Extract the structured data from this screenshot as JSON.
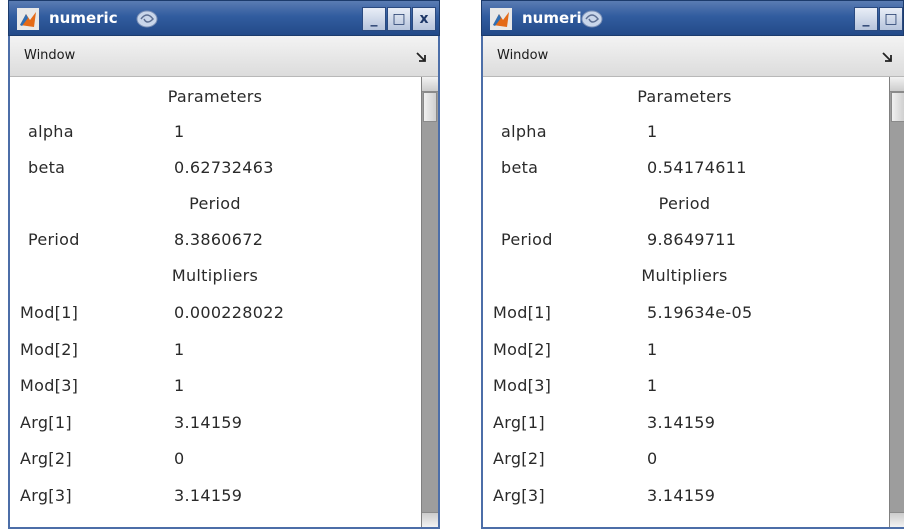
{
  "windows": [
    {
      "title": "numeric",
      "menu": "Window",
      "sections": {
        "parameters_title": "Parameters",
        "period_title": "Period",
        "multipliers_title": "Multipliers"
      },
      "parameters": [
        {
          "key": "alpha",
          "value": "1"
        },
        {
          "key": "beta",
          "value": "0.62732463"
        }
      ],
      "period": [
        {
          "key": "Period",
          "value": "8.3860672"
        }
      ],
      "multipliers": [
        {
          "key": "Mod[1]",
          "value": "0.000228022"
        },
        {
          "key": "Mod[2]",
          "value": "1"
        },
        {
          "key": "Mod[3]",
          "value": "1"
        },
        {
          "key": "Arg[1]",
          "value": "3.14159"
        },
        {
          "key": "Arg[2]",
          "value": "0"
        },
        {
          "key": "Arg[3]",
          "value": "3.14159"
        }
      ]
    },
    {
      "title": "numeric",
      "menu": "Window",
      "sections": {
        "parameters_title": "Parameters",
        "period_title": "Period",
        "multipliers_title": "Multipliers"
      },
      "parameters": [
        {
          "key": "alpha",
          "value": "1"
        },
        {
          "key": "beta",
          "value": "0.54174611"
        }
      ],
      "period": [
        {
          "key": "Period",
          "value": "9.8649711"
        }
      ],
      "multipliers": [
        {
          "key": "Mod[1]",
          "value": "5.19634e-05"
        },
        {
          "key": "Mod[2]",
          "value": "1"
        },
        {
          "key": "Mod[3]",
          "value": "1"
        },
        {
          "key": "Arg[1]",
          "value": "3.14159"
        },
        {
          "key": "Arg[2]",
          "value": "0"
        },
        {
          "key": "Arg[3]",
          "value": "3.14159"
        }
      ]
    }
  ],
  "titlebar_buttons": {
    "minimize": "_",
    "maximize": "□",
    "close": "x"
  },
  "colors": {
    "titlebar": "#315c9f",
    "frame": "#4c6ea8",
    "scrollbar": "#9d9d9d"
  }
}
